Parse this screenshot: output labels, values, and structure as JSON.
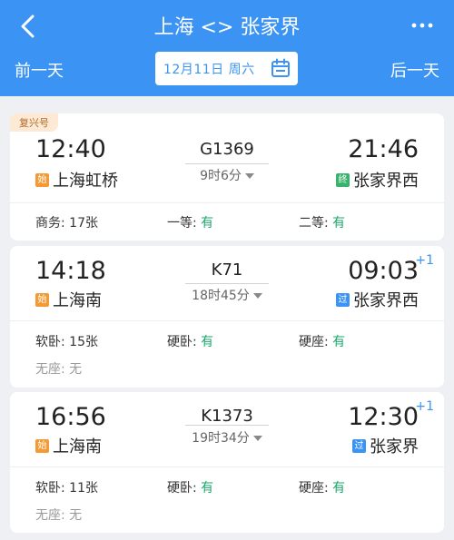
{
  "header": {
    "title": "上海 <> 张家界",
    "prev_day": "前一天",
    "next_day": "后一天",
    "date": "12月11日  周六",
    "accent_color": "#3b93f4"
  },
  "trains": [
    {
      "tag": "复兴号",
      "train_no": "G1369",
      "dep_time": "12:40",
      "arr_time": "21:46",
      "arr_plus": "",
      "dep_badge": "始",
      "dep_station": "上海虹桥",
      "arr_badge": "终",
      "arr_station": "张家界西",
      "duration": "9时6分",
      "seats": [
        {
          "label": "商务: ",
          "value": "17张",
          "available": false
        },
        {
          "label": "一等: ",
          "value": "有",
          "available": true
        },
        {
          "label": "二等: ",
          "value": "有",
          "available": true
        }
      ]
    },
    {
      "tag": "",
      "train_no": "K71",
      "dep_time": "14:18",
      "arr_time": "09:03",
      "arr_plus": "+1",
      "dep_badge": "始",
      "dep_station": "上海南",
      "arr_badge": "过",
      "arr_station": "张家界西",
      "duration": "18时45分",
      "seats": [
        {
          "label": "软卧: ",
          "value": "15张",
          "available": false
        },
        {
          "label": "硬卧: ",
          "value": "有",
          "available": true
        },
        {
          "label": "硬座: ",
          "value": "有",
          "available": true
        },
        {
          "label": "无座: ",
          "value": "无",
          "available": false
        }
      ]
    },
    {
      "tag": "",
      "train_no": "K1373",
      "dep_time": "16:56",
      "arr_time": "12:30",
      "arr_plus": "+1",
      "dep_badge": "始",
      "dep_station": "上海南",
      "arr_badge": "过",
      "arr_station": "张家界",
      "duration": "19时34分",
      "seats": [
        {
          "label": "软卧: ",
          "value": "11张",
          "available": false
        },
        {
          "label": "硬卧: ",
          "value": "有",
          "available": true
        },
        {
          "label": "硬座: ",
          "value": "有",
          "available": true
        },
        {
          "label": "无座: ",
          "value": "无",
          "available": false
        }
      ]
    }
  ]
}
